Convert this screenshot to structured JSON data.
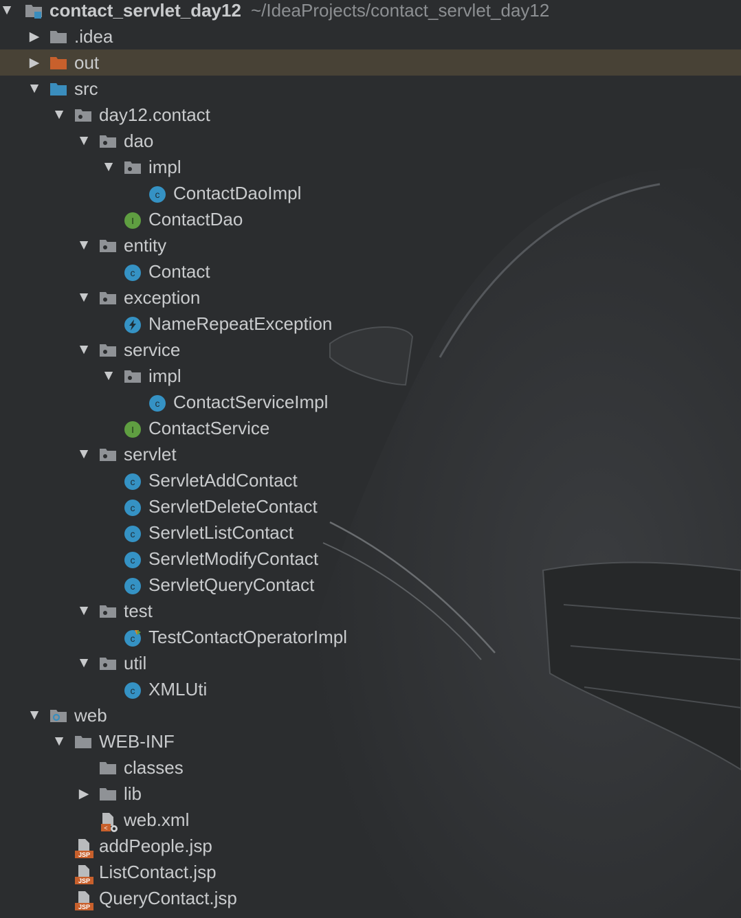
{
  "colors": {
    "background": "#2b2d2f",
    "text": "#c9cbcd",
    "selected_row": "#4f4638",
    "folder": "#8f9296",
    "source_folder": "#3a8dbd",
    "excluded_folder": "#c8602c",
    "class_icon": "#3592c4",
    "interface_icon": "#5f9e41",
    "jsp_icon": "#c8602c"
  },
  "project": {
    "name": "contact_servlet_day12",
    "path": "~/IdeaProjects/contact_servlet_day12"
  },
  "tree": [
    {
      "label": ".idea",
      "icon": "folder-icon",
      "arrow": "collapsed"
    },
    {
      "label": "out",
      "icon": "excluded-folder-icon",
      "arrow": "collapsed",
      "selected": true
    },
    {
      "label": "src",
      "icon": "source-folder-icon",
      "arrow": "expanded"
    },
    {
      "label": "day12.contact",
      "icon": "package-icon",
      "arrow": "expanded"
    },
    {
      "label": "dao",
      "icon": "package-icon",
      "arrow": "expanded"
    },
    {
      "label": "impl",
      "icon": "package-icon",
      "arrow": "expanded"
    },
    {
      "label": "ContactDaoImpl",
      "icon": "class-icon"
    },
    {
      "label": "ContactDao",
      "icon": "interface-icon"
    },
    {
      "label": "entity",
      "icon": "package-icon",
      "arrow": "expanded"
    },
    {
      "label": "Contact",
      "icon": "class-icon"
    },
    {
      "label": "exception",
      "icon": "package-icon",
      "arrow": "expanded"
    },
    {
      "label": "NameRepeatException",
      "icon": "exception-class-icon"
    },
    {
      "label": "service",
      "icon": "package-icon",
      "arrow": "expanded"
    },
    {
      "label": "impl",
      "icon": "package-icon",
      "arrow": "expanded"
    },
    {
      "label": "ContactServiceImpl",
      "icon": "class-icon"
    },
    {
      "label": "ContactService",
      "icon": "interface-icon"
    },
    {
      "label": "servlet",
      "icon": "package-icon",
      "arrow": "expanded"
    },
    {
      "label": "ServletAddContact",
      "icon": "class-icon"
    },
    {
      "label": "ServletDeleteContact",
      "icon": "class-icon"
    },
    {
      "label": "ServletListContact",
      "icon": "class-icon"
    },
    {
      "label": "ServletModifyContact",
      "icon": "class-icon"
    },
    {
      "label": "ServletQueryContact",
      "icon": "class-icon"
    },
    {
      "label": "test",
      "icon": "package-icon",
      "arrow": "expanded"
    },
    {
      "label": "TestContactOperatorImpl",
      "icon": "test-class-icon"
    },
    {
      "label": "util",
      "icon": "package-icon",
      "arrow": "expanded"
    },
    {
      "label": "XMLUti",
      "icon": "class-icon"
    },
    {
      "label": "web",
      "icon": "web-folder-icon",
      "arrow": "expanded"
    },
    {
      "label": "WEB-INF",
      "icon": "folder-icon",
      "arrow": "expanded"
    },
    {
      "label": "classes",
      "icon": "folder-icon"
    },
    {
      "label": "lib",
      "icon": "folder-icon",
      "arrow": "collapsed"
    },
    {
      "label": "web.xml",
      "icon": "xml-file-icon"
    },
    {
      "label": "addPeople.jsp",
      "icon": "jsp-file-icon"
    },
    {
      "label": "ListContact.jsp",
      "icon": "jsp-file-icon"
    },
    {
      "label": "QueryContact.jsp",
      "icon": "jsp-file-icon"
    }
  ]
}
